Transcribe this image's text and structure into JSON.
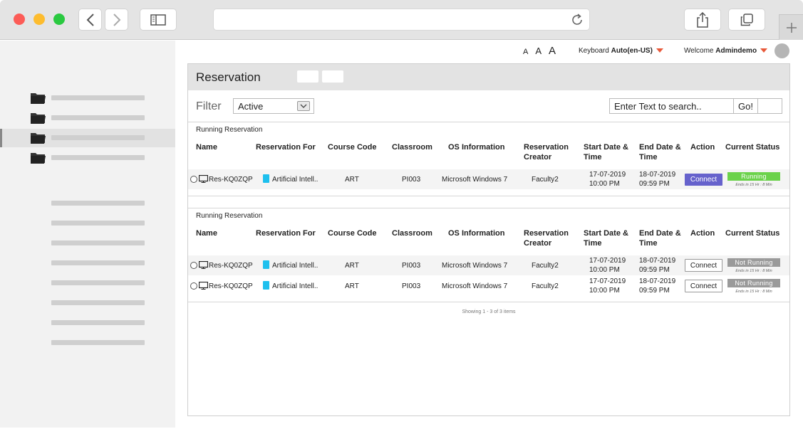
{
  "browser": {
    "icons": [
      "back-icon",
      "forward-icon",
      "sidebar-toggle-icon",
      "reload-icon",
      "share-icon",
      "tabs-icon",
      "new-tab-icon"
    ]
  },
  "topbar": {
    "font_sizes": [
      "A",
      "A",
      "A"
    ],
    "keyboard_label": "Keyboard",
    "keyboard_value": "Auto(en-US)",
    "welcome_label": "Welcome",
    "username": "Admindemo"
  },
  "page": {
    "title": "Reservation"
  },
  "filter": {
    "label": "Filter",
    "selected": "Active",
    "search_value": "Enter Text to search..",
    "go_label": "Go!"
  },
  "columns": [
    "Name",
    "Reservation For",
    "Course Code",
    "Classroom",
    "OS Information",
    "Reservation Creator",
    "Start Date & Time",
    "End Date & Time",
    "Action",
    "Current Status"
  ],
  "sections": [
    {
      "title": "Running Reservation",
      "rows": [
        {
          "name": "Res-KQ0ZQP",
          "reservation_for": "Artificial Intell..",
          "course_code": "ART",
          "classroom": "PI003",
          "os": "Microsoft Windows 7",
          "creator": "Faculty2",
          "start_date": "17-07-2019",
          "start_time": "10:00 PM",
          "end_date": "18-07-2019",
          "end_time": "09:59 PM",
          "action": "Connect",
          "status": "Running",
          "ends_in": "Ends in 15 Hr : 8 Min"
        }
      ]
    },
    {
      "title": "Running Reservation",
      "rows": [
        {
          "name": "Res-KQ0ZQP",
          "reservation_for": "Artificial Intell..",
          "course_code": "ART",
          "classroom": "PI003",
          "os": "Microsoft Windows 7",
          "creator": "Faculty2",
          "start_date": "17-07-2019",
          "start_time": "10:00 PM",
          "end_date": "18-07-2019",
          "end_time": "09:59 PM",
          "action": "Connect",
          "status": "Not Running",
          "ends_in": "Ends in 15 Hr : 8 Min"
        },
        {
          "name": "Res-KQ0ZQP",
          "reservation_for": "Artificial Intell..",
          "course_code": "ART",
          "classroom": "PI003",
          "os": "Microsoft Windows 7",
          "creator": "Faculty2",
          "start_date": "17-07-2019",
          "start_time": "10:00 PM",
          "end_date": "18-07-2019",
          "end_time": "09:59 PM",
          "action": "Connect",
          "status": "Not Running",
          "ends_in": "Ends in 15 Hr : 8 Min"
        }
      ]
    }
  ],
  "pagination": {
    "summary": "Showing 1 - 3 of 3 items"
  },
  "colors": {
    "connect_primary": "#6662cc",
    "status_running": "#6bd24b",
    "status_not_running": "#9a9a9a",
    "dropdown_caret": "#e8593a"
  }
}
